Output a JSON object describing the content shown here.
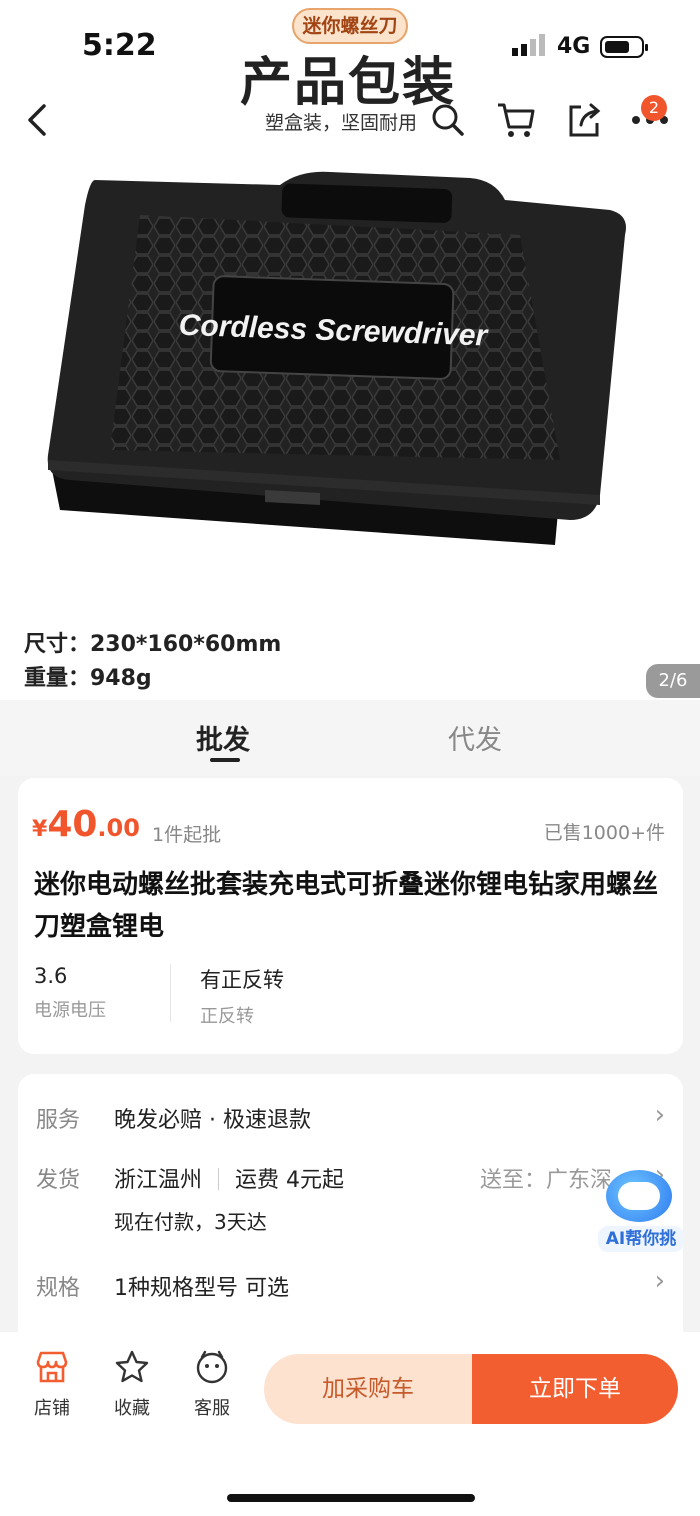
{
  "status": {
    "time": "5:22",
    "network": "4G"
  },
  "gallery": {
    "tagline": "迷你螺丝刀",
    "headline": "产品包装",
    "subline": "塑盒装，坚固耐用",
    "case_logo_text": "Cordless Screwdriver",
    "size_line": "尺寸：230*160*60mm",
    "weight_line": "重量：948g",
    "page_indicator": "2/6"
  },
  "nav": {
    "cart_badge": "2"
  },
  "tabs": [
    {
      "label": "批发"
    },
    {
      "label": "代发"
    }
  ],
  "product": {
    "currency": "¥",
    "price_int": "40",
    "price_dec": ".00",
    "min_order": "1件起批",
    "sold": "已售1000+件",
    "title": "迷你电动螺丝批套装充电式可折叠迷你锂电钻家用螺丝刀塑盒锂电",
    "attributes": [
      {
        "value": "3.6",
        "key": "电源电压"
      },
      {
        "value": "有正反转",
        "key": "正反转"
      }
    ]
  },
  "service": {
    "service_label": "服务",
    "service_value": "晚发必赔 · 极速退款",
    "ship_label": "发货",
    "ship_origin": "浙江温州",
    "ship_fee": "运费 4元起",
    "ship_to": "送至：广东深圳",
    "ship_eta": "现在付款，3天达",
    "spec_label": "规格",
    "spec_value": "1种规格型号 可选"
  },
  "ai_helper": {
    "label": "AI帮你挑"
  },
  "bottom": {
    "store": "店铺",
    "favorite": "收藏",
    "service": "客服",
    "add_cart": "加采购车",
    "buy_now": "立即下单"
  },
  "colors": {
    "accent": "#f25e30",
    "price": "#f0552c",
    "cart_button_bg": "#fde2cf"
  }
}
